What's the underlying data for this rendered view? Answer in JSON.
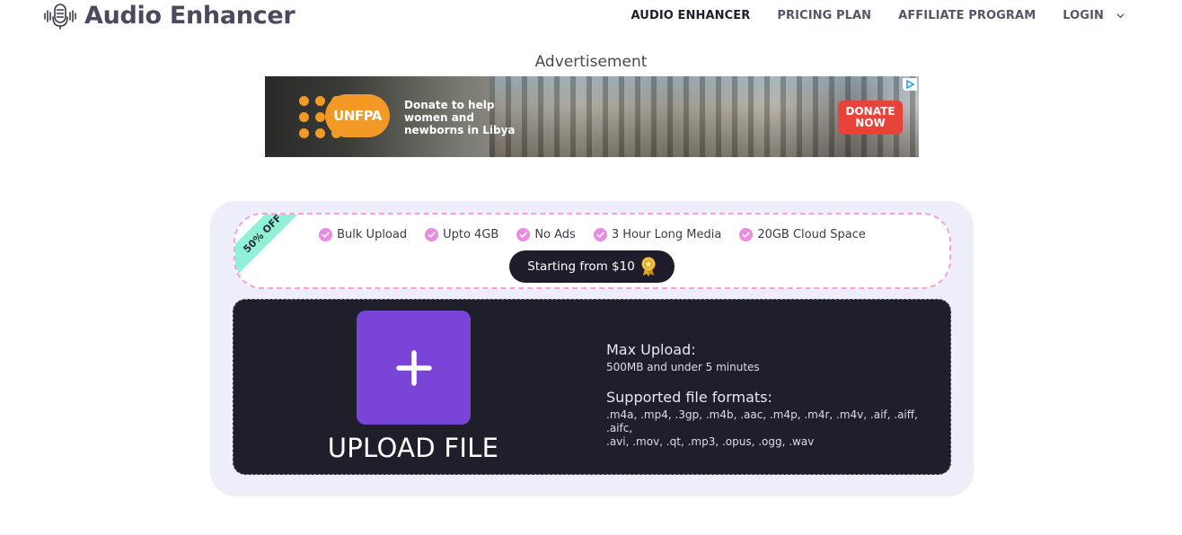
{
  "header": {
    "app_title": "Audio Enhancer",
    "logo_icon": "microphone-waveform-icon",
    "nav": [
      {
        "label": "AUDIO ENHANCER",
        "active": true
      },
      {
        "label": "PRICING PLAN",
        "active": false
      },
      {
        "label": "AFFILIATE PROGRAM",
        "active": false
      },
      {
        "label": "LOGIN",
        "active": false,
        "icon": "chevron-down-icon"
      }
    ]
  },
  "ad": {
    "label": "Advertisement",
    "org": "UNFPA",
    "text_lines": [
      "Donate to help",
      "women and",
      "newborns in Libya"
    ],
    "donate_lines": [
      "DONATE",
      "NOW"
    ],
    "colors": {
      "orange": "#f39a26",
      "donate_red": "#e8433a"
    }
  },
  "promo": {
    "ribbon": "50% OFF",
    "features": [
      "Bulk Upload",
      "Upto 4GB",
      "No Ads",
      "3 Hour Long Media",
      "20GB Cloud Space"
    ],
    "feature_icon": "check-circle-icon",
    "price_button": "Starting from $10",
    "price_icon": "award-medal-icon",
    "colors": {
      "check": "#e98be0",
      "ribbon": "#90f0d8",
      "border": "#f2a3dc"
    }
  },
  "upload": {
    "button_icon": "plus-icon",
    "label": "UPLOAD FILE",
    "max_upload_title": "Max Upload:",
    "max_upload_value": "500MB and under 5 minutes",
    "formats_title": "Supported file formats:",
    "formats_line1": ".m4a, .mp4, .3gp, .m4b, .aac, .m4p, .m4r, .m4v, .aif, .aiff, .aifc,",
    "formats_line2": ".avi, .mov, .qt, .mp3, .opus, .ogg, .wav",
    "colors": {
      "button": "#7b44d8",
      "panel": "#1f1f2c",
      "card": "#eeeefb"
    }
  }
}
